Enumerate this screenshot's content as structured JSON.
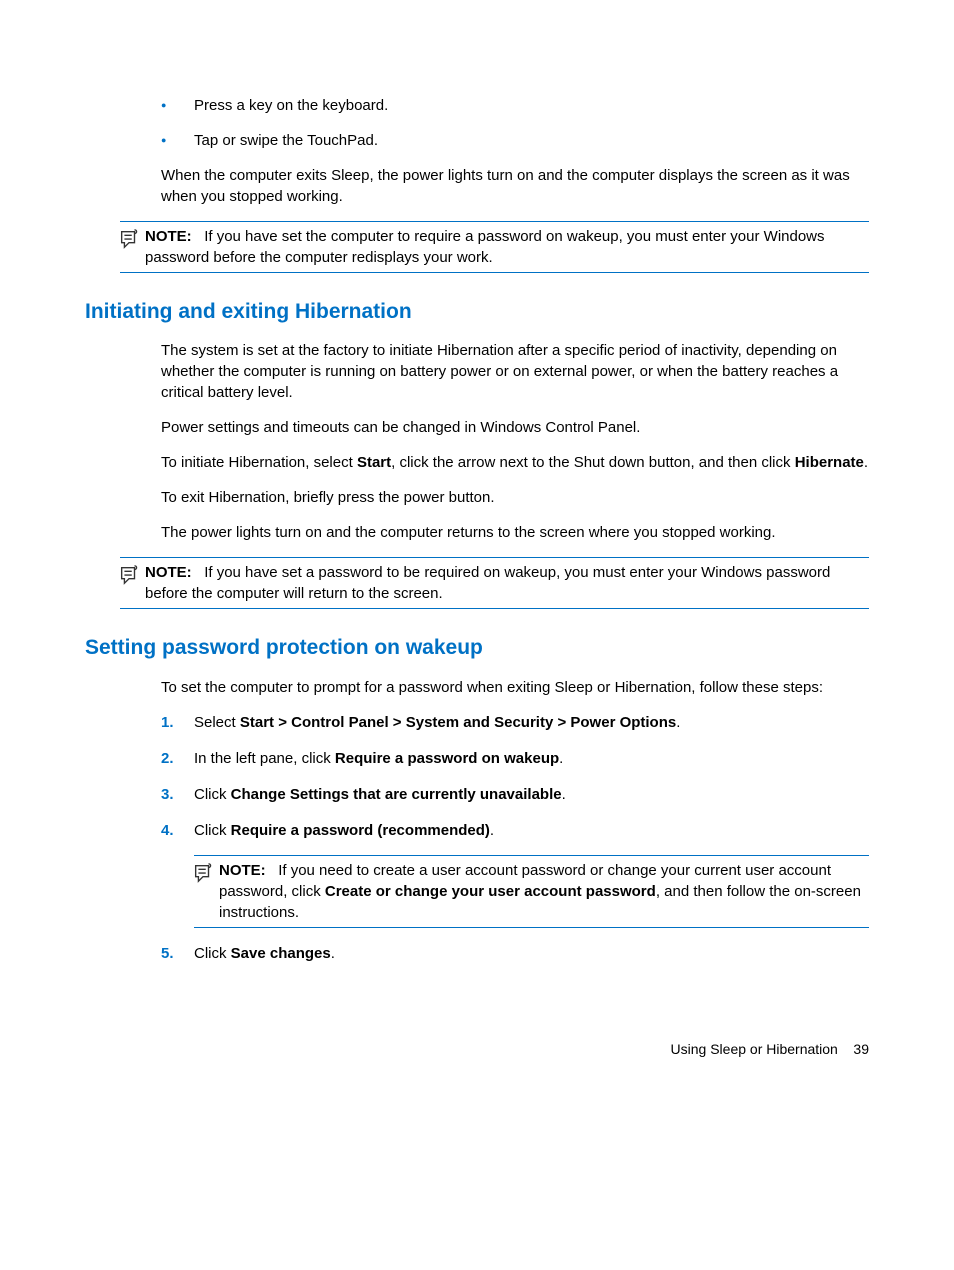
{
  "bullets_top": [
    "Press a key on the keyboard.",
    "Tap or swipe the TouchPad."
  ],
  "para_after_bullets": "When the computer exits Sleep, the power lights turn on and the computer displays the screen as it was when you stopped working.",
  "note1": {
    "label": "NOTE:",
    "text": "If you have set the computer to require a password on wakeup, you must enter your Windows password before the computer redisplays your work."
  },
  "section1": {
    "heading": "Initiating and exiting Hibernation",
    "p1": "The system is set at the factory to initiate Hibernation after a specific period of inactivity, depending on whether the computer is running on battery power or on external power, or when the battery reaches a critical battery level.",
    "p2": "Power settings and timeouts can be changed in Windows Control Panel.",
    "p3_pre": "To initiate Hibernation, select ",
    "p3_b1": "Start",
    "p3_mid": ", click the arrow next to the Shut down button, and then click ",
    "p3_b2": "Hibernate",
    "p3_post": ".",
    "p4": "To exit Hibernation, briefly press the power button.",
    "p5": "The power lights turn on and the computer returns to the screen where you stopped working."
  },
  "note2": {
    "label": "NOTE:",
    "text": "If you have set a password to be required on wakeup, you must enter your Windows password before the computer will return to the screen."
  },
  "section2": {
    "heading": "Setting password protection on wakeup",
    "intro": "To set the computer to prompt for a password when exiting Sleep or Hibernation, follow these steps:",
    "s1_pre": "Select ",
    "s1_b": "Start > Control Panel > System and Security > Power Options",
    "s1_post": ".",
    "s2_pre": "In the left pane, click ",
    "s2_b": "Require a password on wakeup",
    "s2_post": ".",
    "s3_pre": "Click ",
    "s3_b": "Change Settings that are currently unavailable",
    "s3_post": ".",
    "s4_pre": "Click ",
    "s4_b": "Require a password (recommended)",
    "s4_post": ".",
    "s5_pre": "Click ",
    "s5_b": "Save changes",
    "s5_post": "."
  },
  "note3": {
    "label": "NOTE:",
    "pre": "If you need to create a user account password or change your current user account password, click ",
    "bold": "Create or change your user account password",
    "post": ", and then follow the on-screen instructions."
  },
  "footer": {
    "text": "Using Sleep or Hibernation",
    "page": "39"
  }
}
